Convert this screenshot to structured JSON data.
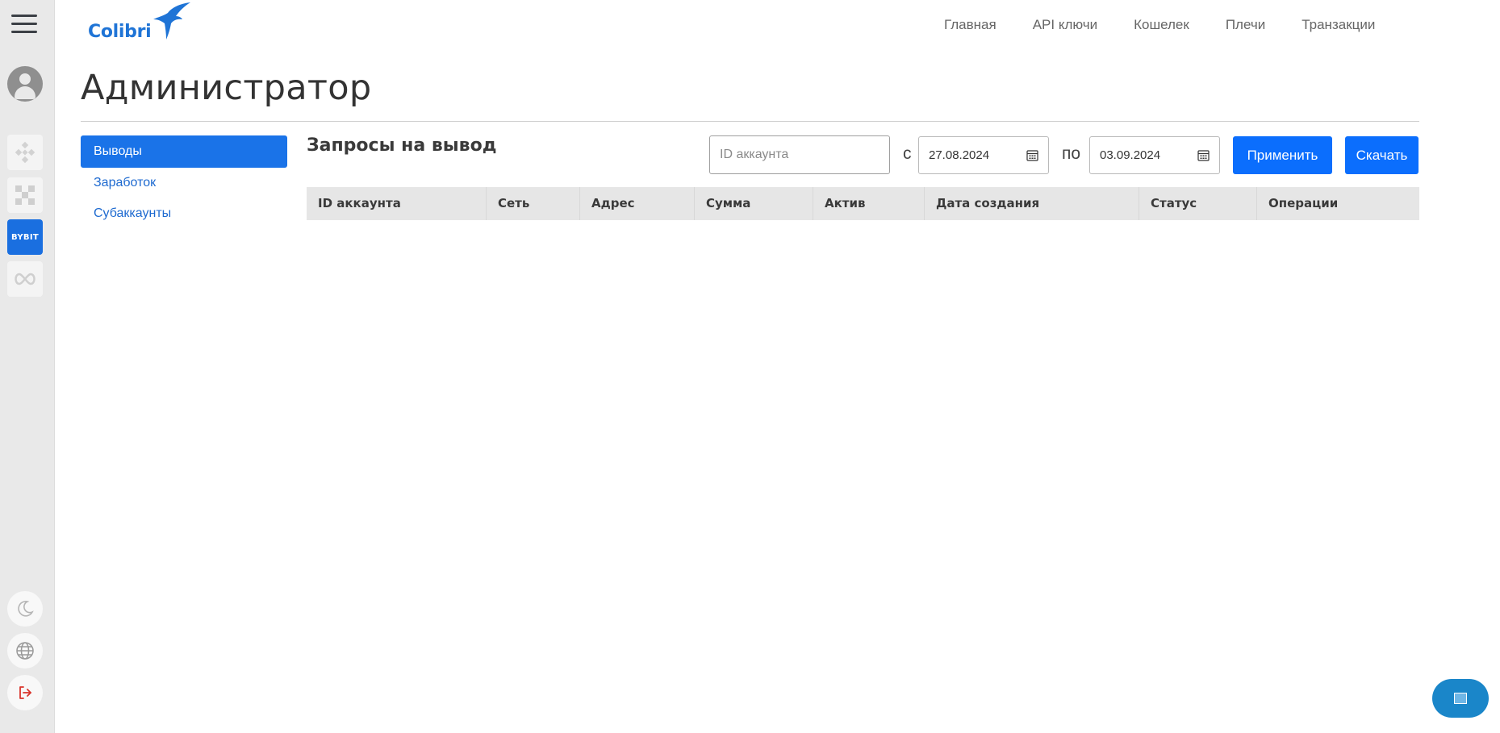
{
  "logo": {
    "text": "Colibri"
  },
  "topnav": {
    "items": [
      {
        "label": "Главная"
      },
      {
        "label": "API ключи"
      },
      {
        "label": "Кошелек"
      },
      {
        "label": "Плечи"
      },
      {
        "label": "Транзакции"
      }
    ]
  },
  "rail": {
    "exchanges": [
      {
        "icon": "binance-icon"
      },
      {
        "icon": "okx-icon"
      },
      {
        "icon": "bybit-icon",
        "label": "BYBIT"
      },
      {
        "icon": "infinity-link-icon"
      }
    ],
    "bottom": [
      {
        "icon": "moon-icon"
      },
      {
        "icon": "globe-icon"
      },
      {
        "icon": "logout-icon"
      }
    ],
    "colors": {
      "bybit": "#1a6fe0",
      "logout": "#d9342b"
    }
  },
  "page": {
    "title": "Администратор"
  },
  "sidemenu": {
    "items": [
      {
        "label": "Выводы",
        "active": true
      },
      {
        "label": "Заработок"
      },
      {
        "label": "Субаккаунты"
      }
    ]
  },
  "content": {
    "title": "Запросы на вывод",
    "filters": {
      "account_placeholder": "ID аккаунта",
      "from_label": "с",
      "from_date": "27.08.2024",
      "to_label": "по",
      "to_date": "03.09.2024",
      "apply_label": "Применить",
      "download_label": "Скачать"
    },
    "table": {
      "columns": [
        "ID аккаунта",
        "Сеть",
        "Адрес",
        "Сумма",
        "Актив",
        "Дата создания",
        "Статус",
        "Операции"
      ]
    }
  },
  "accent": "#0b6efd"
}
